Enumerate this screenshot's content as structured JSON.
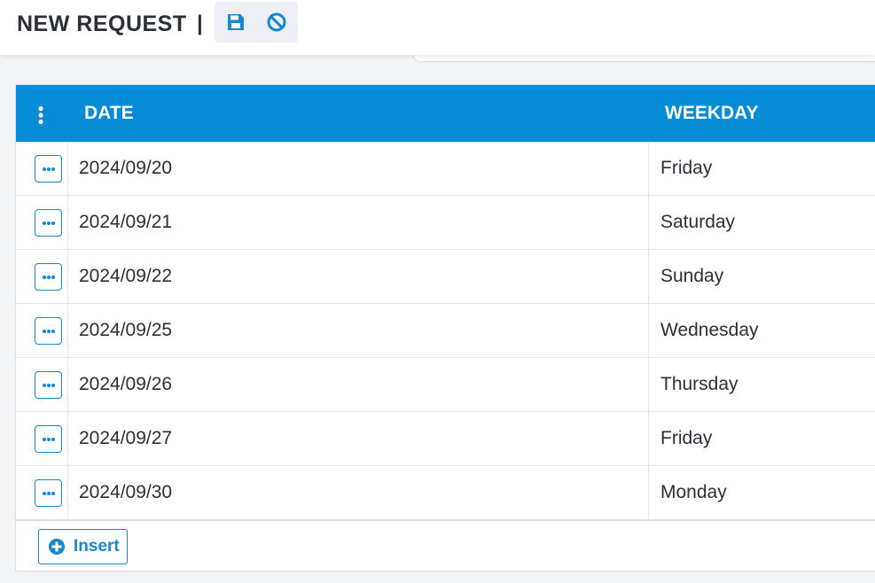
{
  "header": {
    "title": "NEW REQUEST",
    "separator": "|",
    "tools": [
      {
        "icon": "save-icon",
        "label": "Save"
      },
      {
        "icon": "cancel-icon",
        "label": "Cancel"
      }
    ]
  },
  "grid": {
    "columns": [
      "DATE",
      "WEEKDAY"
    ],
    "rows": [
      {
        "date": "2024/09/20",
        "weekday": "Friday"
      },
      {
        "date": "2024/09/21",
        "weekday": "Saturday"
      },
      {
        "date": "2024/09/22",
        "weekday": "Sunday"
      },
      {
        "date": "2024/09/25",
        "weekday": "Wednesday"
      },
      {
        "date": "2024/09/26",
        "weekday": "Thursday"
      },
      {
        "date": "2024/09/27",
        "weekday": "Friday"
      },
      {
        "date": "2024/09/30",
        "weekday": "Monday"
      }
    ],
    "insert_label": "Insert"
  },
  "colors": {
    "accent": "#068cd6",
    "button_border": "#1588d0",
    "text": "#2b2f36"
  }
}
